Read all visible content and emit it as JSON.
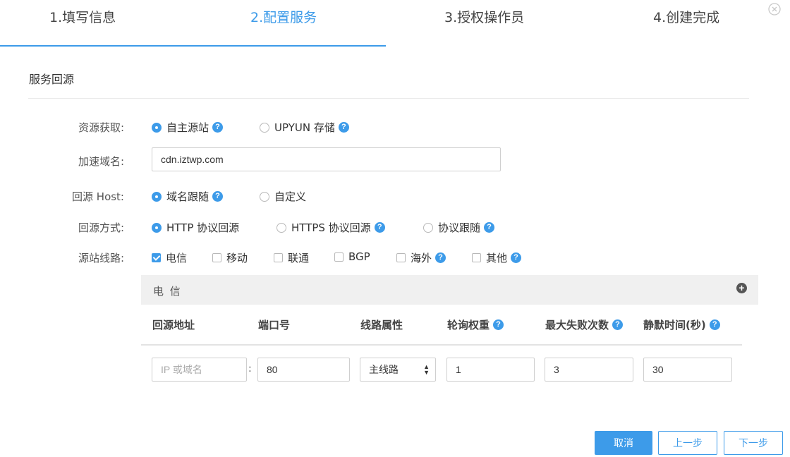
{
  "steps": [
    {
      "label": "1.填写信息",
      "state": "done"
    },
    {
      "label": "2.配置服务",
      "state": "active"
    },
    {
      "label": "3.授权操作员",
      "state": "pending"
    },
    {
      "label": "4.创建完成",
      "state": "pending"
    }
  ],
  "accent_color": "#3d9be9",
  "close_icon": "close-circle-icon",
  "section": {
    "title": "服务回源"
  },
  "form": {
    "resource": {
      "label": "资源获取:",
      "options": [
        {
          "label": "自主源站",
          "checked": true,
          "help": "?"
        },
        {
          "label": "UPYUN 存储",
          "checked": false,
          "help": "?"
        }
      ]
    },
    "domain": {
      "label": "加速域名:",
      "value": "cdn.iztwp.com"
    },
    "host": {
      "label": "回源 Host:",
      "options": [
        {
          "label": "域名跟随",
          "checked": true,
          "help": "?"
        },
        {
          "label": "自定义",
          "checked": false
        }
      ]
    },
    "method": {
      "label": "回源方式:",
      "options": [
        {
          "label": "HTTP 协议回源",
          "checked": true
        },
        {
          "label": "HTTPS 协议回源",
          "checked": false,
          "help": "?"
        },
        {
          "label": "协议跟随",
          "checked": false,
          "help": "?"
        }
      ]
    },
    "lines": {
      "label": "源站线路:",
      "options": [
        {
          "label": "电信",
          "checked": true
        },
        {
          "label": "移动",
          "checked": false
        },
        {
          "label": "联通",
          "checked": false
        },
        {
          "label": "BGP",
          "checked": false
        },
        {
          "label": "海外",
          "checked": false,
          "help": "?"
        },
        {
          "label": "其他",
          "checked": false,
          "help": "?"
        }
      ]
    }
  },
  "panel": {
    "title": "电 信",
    "add_icon": "+",
    "columns": [
      {
        "label": "回源地址"
      },
      {
        "label": "端口号"
      },
      {
        "label": "线路属性"
      },
      {
        "label": "轮询权重",
        "help": "?"
      },
      {
        "label": "最大失败次数",
        "help": "?"
      },
      {
        "label": "静默时间(秒)",
        "help": "?"
      }
    ],
    "row": {
      "address_placeholder": "IP 或域名",
      "separator": ":",
      "port": "80",
      "line_type": "主线路",
      "weight": "1",
      "max_fails": "3",
      "silent_time": "30"
    }
  },
  "buttons": {
    "cancel": "取消",
    "prev": "上一步",
    "next": "下一步"
  }
}
